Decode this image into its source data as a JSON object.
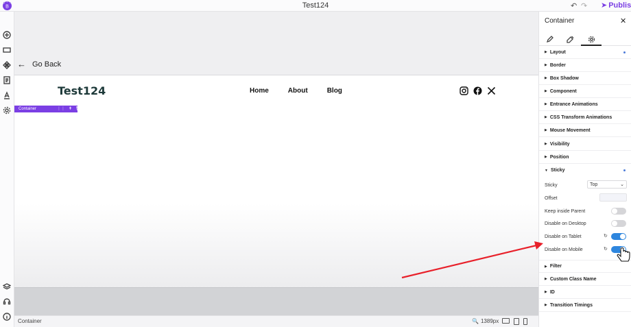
{
  "app": {
    "title": "Test124",
    "publish_label": "Publish",
    "undo_icon": "undo-icon",
    "redo_icon": "redo-icon"
  },
  "colors": {
    "accent": "#7b3fe4",
    "toggle_on": "#2e86de",
    "annotation_arrow": "#e8202a"
  },
  "leftbar": {
    "icons": [
      "add-icon",
      "section-icon",
      "components-icon",
      "pages-icon",
      "typography-icon",
      "settings-icon",
      "layers-icon",
      "support-icon",
      "info-icon"
    ]
  },
  "canvas": {
    "go_back_label": "Go Back",
    "site": {
      "logo_text": "Test124",
      "nav": [
        "Home",
        "About",
        "Blog"
      ],
      "social_icons": [
        "instagram-icon",
        "facebook-icon",
        "x-icon"
      ]
    },
    "selected_badge": "Container"
  },
  "statusbar": {
    "label": "Container",
    "zoom": "1389px"
  },
  "panel": {
    "title": "Container",
    "tabs": [
      "style-icon",
      "design-icon",
      "settings-icon"
    ],
    "sections": [
      {
        "label": "Layout",
        "modified": true
      },
      {
        "label": "Border",
        "modified": false
      },
      {
        "label": "Box Shadow",
        "modified": false
      },
      {
        "label": "Component",
        "modified": false
      },
      {
        "label": "Entrance Animations",
        "modified": false
      },
      {
        "label": "CSS Transform Animations",
        "modified": false
      },
      {
        "label": "Mouse Movement",
        "modified": false
      },
      {
        "label": "Visibility",
        "modified": false
      },
      {
        "label": "Position",
        "modified": false
      },
      {
        "label": "Sticky",
        "modified": true
      }
    ],
    "sticky": {
      "sticky_label": "Sticky",
      "sticky_value": "Top",
      "offset_label": "Offset",
      "offset_value": "",
      "keep_inside_label": "Keep inside Parent",
      "keep_inside_on": false,
      "disable_desktop_label": "Disable on Desktop",
      "disable_desktop_on": false,
      "disable_tablet_label": "Disable on Tablet",
      "disable_tablet_on": true,
      "disable_mobile_label": "Disable on Mobile",
      "disable_mobile_on": true
    },
    "sections_after": [
      {
        "label": "Filter"
      },
      {
        "label": "Custom Class Name"
      },
      {
        "label": "ID"
      },
      {
        "label": "Transition Timings"
      }
    ]
  }
}
